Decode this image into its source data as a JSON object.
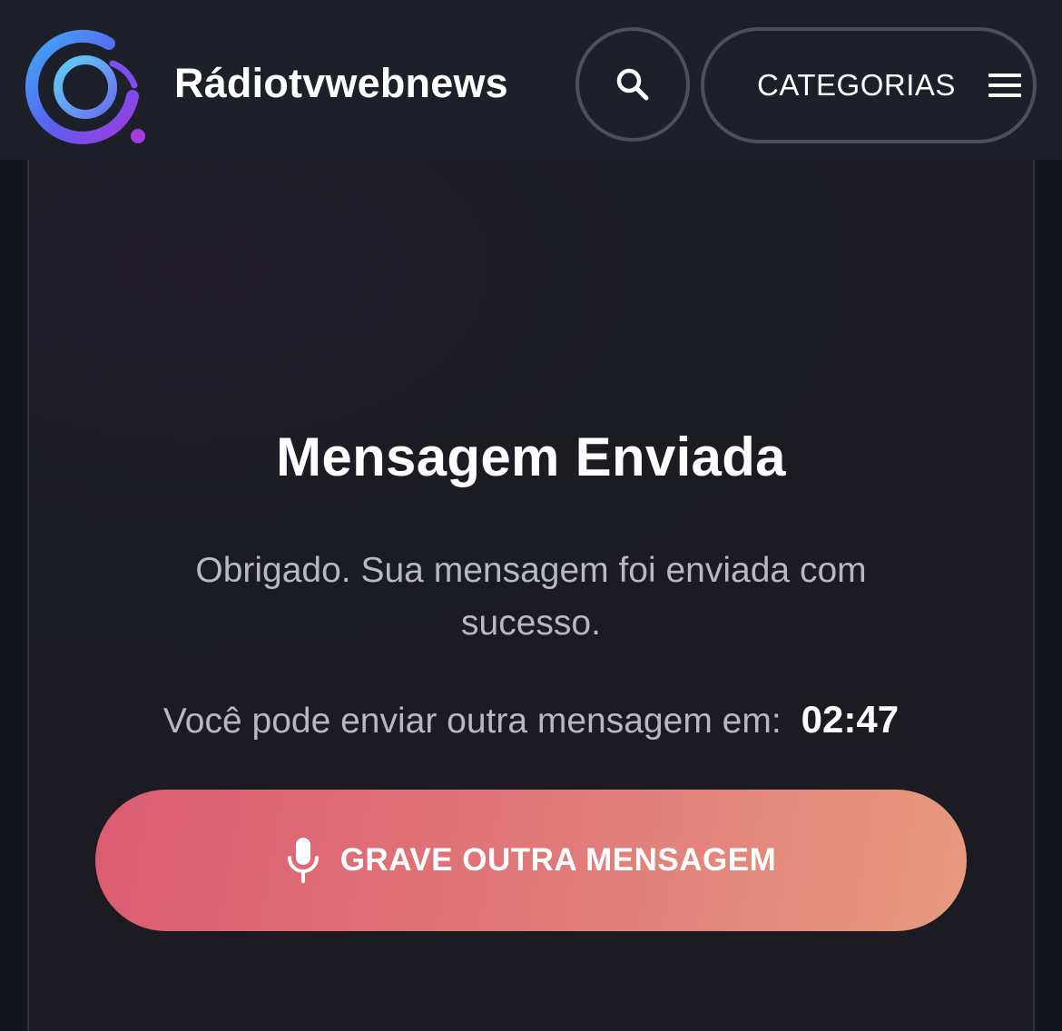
{
  "header": {
    "brand": "Rádiotvwebnews",
    "logo_icon": "radio-q-logo",
    "search_icon": "search-icon",
    "categories_label": "CATEGORIAS",
    "menu_icon": "hamburger-menu-icon",
    "background": "#1d2029",
    "button_border": "#4b505c"
  },
  "main": {
    "title": "Mensagem Enviada",
    "message": "Obrigado. Sua mensagem foi enviada com sucesso.",
    "countdown_label": "Você pode enviar outra mensagem em:",
    "countdown_time": "02:47",
    "record_button": {
      "icon": "microphone-icon",
      "label": "GRAVE OUTRA MENSAGEM",
      "gradient_start": "#dc5b71",
      "gradient_end": "#e79a7f"
    }
  }
}
